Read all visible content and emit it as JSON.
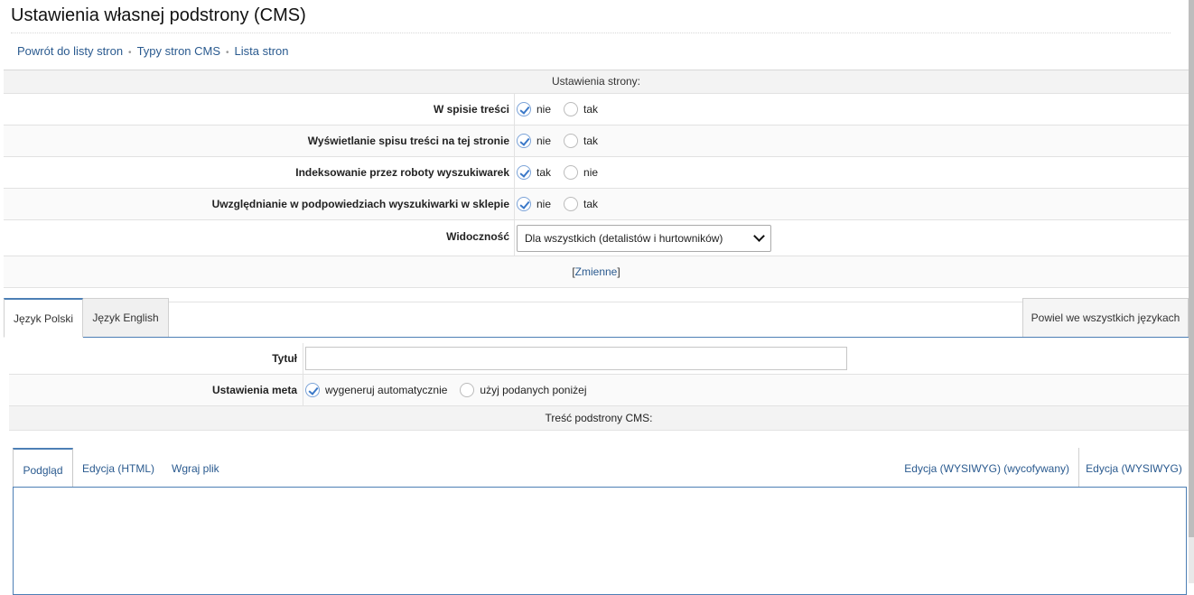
{
  "page": {
    "title": "Ustawienia własnej podstrony (CMS)"
  },
  "breadcrumb": {
    "items": [
      "Powrót do listy stron",
      "Typy stron CMS",
      "Lista stron"
    ],
    "separator": "•"
  },
  "settings": {
    "header": "Ustawienia strony:",
    "rows": [
      {
        "label": "W spisie treści",
        "options": [
          {
            "label": "nie",
            "checked": true
          },
          {
            "label": "tak",
            "checked": false
          }
        ]
      },
      {
        "label": "Wyświetlanie spisu treści na tej stronie",
        "options": [
          {
            "label": "nie",
            "checked": true
          },
          {
            "label": "tak",
            "checked": false
          }
        ]
      },
      {
        "label": "Indeksowanie przez roboty wyszukiwarek",
        "options": [
          {
            "label": "tak",
            "checked": true
          },
          {
            "label": "nie",
            "checked": false
          }
        ]
      },
      {
        "label": "Uwzględnianie w podpowiedziach wyszukiwarki w sklepie",
        "options": [
          {
            "label": "nie",
            "checked": true
          },
          {
            "label": "tak",
            "checked": false
          }
        ]
      }
    ],
    "visibility": {
      "label": "Widoczność",
      "selected": "Dla wszystkich (detalistów i hurtowników)"
    },
    "variables": {
      "open": "[",
      "link": "Zmienne",
      "close": "]"
    }
  },
  "language_tabs": {
    "tabs": [
      "Język Polski",
      "Język English"
    ],
    "active": 0,
    "repeat_label": "Powiel we wszystkich językach"
  },
  "language_panel": {
    "title_label": "Tytuł",
    "title_value": "",
    "meta_label": "Ustawienia meta",
    "meta_options": [
      {
        "label": "wygeneruj automatycznie",
        "checked": true
      },
      {
        "label": "użyj podanych poniżej",
        "checked": false
      }
    ],
    "content_header": "Treść podstrony CMS:"
  },
  "editor_tabs": {
    "preview": "Podgląd",
    "html": "Edycja (HTML)",
    "upload": "Wgraj plik",
    "wysiwyg_deprecated": "Edycja (WYSIWYG) (wycofywany)",
    "wysiwyg": "Edycja (WYSIWYG)"
  },
  "colors": {
    "link": "#2a5a8f",
    "accent": "#4d7fb5",
    "check": "#3a78c8"
  }
}
